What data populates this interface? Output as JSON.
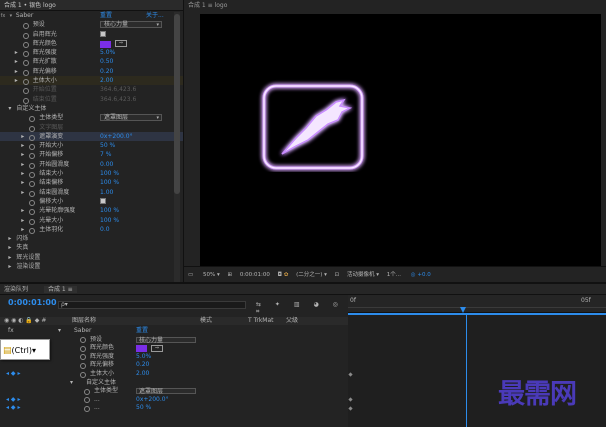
{
  "effects_panel": {
    "header": "合成 1 • 银色 logo",
    "effect_name": "Saber",
    "reset_label": "重置",
    "about_label": "关于...",
    "rows": [
      {
        "label": "预设",
        "value": "核心力量",
        "type": "dropdown"
      },
      {
        "label": "启用辉光",
        "value": "",
        "type": "checkbox"
      },
      {
        "label": "辉光颜色",
        "value": "",
        "type": "color"
      },
      {
        "label": "辉光强度",
        "value": "5.0%",
        "type": "value"
      },
      {
        "label": "辉光扩散",
        "value": "0.50",
        "type": "value"
      },
      {
        "label": "辉光偏移",
        "value": "0.20",
        "type": "value"
      },
      {
        "label": "主体大小",
        "value": "2.00",
        "type": "value"
      },
      {
        "label": "开始位置",
        "value": "364.6,423.6",
        "type": "dim"
      },
      {
        "label": "结束位置",
        "value": "364.6,423.6",
        "type": "dim"
      },
      {
        "label": "自定义主体",
        "value": "",
        "type": "group"
      },
      {
        "label": "主体类型",
        "value": "遮罩图层",
        "type": "dropdown"
      },
      {
        "label": "文字图层",
        "value": "",
        "type": "dim"
      },
      {
        "label": "遮罩演变",
        "value": "0x+200.0°",
        "type": "value"
      },
      {
        "label": "开始大小",
        "value": "50 %",
        "type": "value"
      },
      {
        "label": "开始偏移",
        "value": "7 %",
        "type": "value"
      },
      {
        "label": "开始圆滑度",
        "value": "0.00",
        "type": "value"
      },
      {
        "label": "结束大小",
        "value": "100 %",
        "type": "value"
      },
      {
        "label": "结束偏移",
        "value": "100 %",
        "type": "value"
      },
      {
        "label": "结束圆滑度",
        "value": "1.00",
        "type": "value"
      },
      {
        "label": "偏移大小",
        "value": "",
        "type": "checkbox"
      },
      {
        "label": "光晕轮廓强度",
        "value": "100 %",
        "type": "value"
      },
      {
        "label": "光晕大小",
        "value": "100 %",
        "type": "value"
      },
      {
        "label": "主体羽化",
        "value": "0.0",
        "type": "value"
      },
      {
        "label": "闪烁",
        "value": "",
        "type": "group"
      },
      {
        "label": "失真",
        "value": "",
        "type": "group"
      },
      {
        "label": "辉光设置",
        "value": "",
        "type": "group"
      },
      {
        "label": "渲染设置",
        "value": "",
        "type": "group"
      }
    ]
  },
  "composition": {
    "tab": "合成 1 ≡ logo",
    "zoom": "50%",
    "timecode": "0:00:01:00",
    "resolution": "(二分之一)",
    "camera": "活动摄像机",
    "views": "1个...",
    "exposure": "+0.0"
  },
  "timeline": {
    "tabs": [
      "渲染队列",
      "合成 1 ≡"
    ],
    "timecode": "0:00:01:00",
    "search_placeholder": "ρ▾",
    "columns": [
      "图层名称",
      "模式",
      "T TrkMat",
      "父级"
    ],
    "ruler": [
      "0f",
      "05f"
    ],
    "rows": [
      {
        "label": "Saber",
        "value": "重置"
      },
      {
        "label": "预设",
        "value": "核心力量"
      },
      {
        "label": "辉光颜色",
        "value": ""
      },
      {
        "label": "辉光强度",
        "value": "5.0%"
      },
      {
        "label": "辉光偏移",
        "value": "0.20"
      },
      {
        "label": "主体大小",
        "value": "2.00"
      },
      {
        "label": "自定义主体",
        "value": ""
      },
      {
        "label": "主体类型",
        "value": "遮罩图层"
      },
      {
        "label": "...",
        "value": "0x+200.0°"
      },
      {
        "label": "...",
        "value": "50 %"
      }
    ]
  },
  "tooltip": {
    "text": "(Ctrl)▾"
  },
  "watermark": "最需网",
  "colors": {
    "accent_blue": "#2d8ceb",
    "glow_purple": "#7a2ee6",
    "keyframe_blue": "#2d8ceb"
  }
}
